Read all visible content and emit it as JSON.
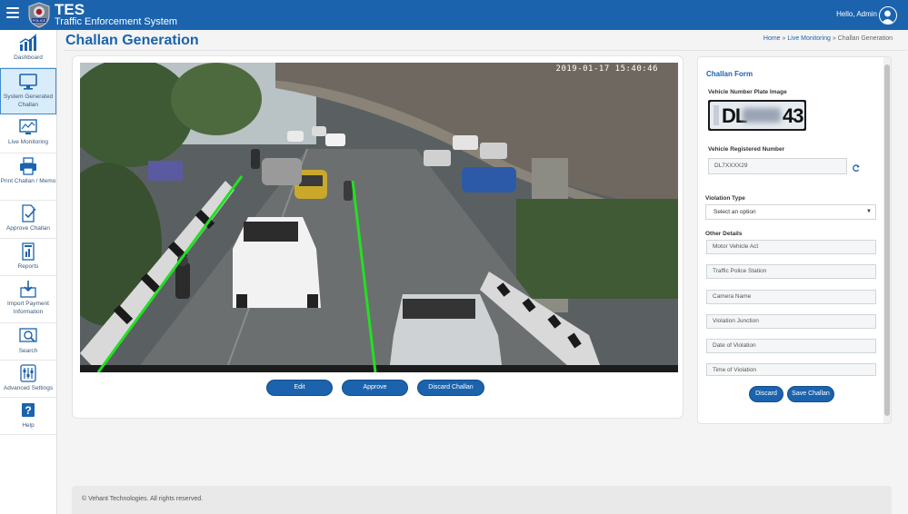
{
  "header": {
    "app_name": "TES",
    "app_subtitle": "Traffic Enforcement System",
    "greeting": "Hello, Admin",
    "logo_text": "POLICE"
  },
  "sidebar": {
    "items": [
      {
        "label": "Dashboard",
        "icon": "bar-chart-icon"
      },
      {
        "label": "System Generated Challan",
        "icon": "monitor-icon",
        "active": true
      },
      {
        "label": "Live Monitoring",
        "icon": "trend-monitor-icon"
      },
      {
        "label": "Print Challan / Memo",
        "icon": "printer-icon"
      },
      {
        "label": "Approve Challan",
        "icon": "approve-document-icon"
      },
      {
        "label": "Reports",
        "icon": "report-icon"
      },
      {
        "label": "Import Payment Information",
        "icon": "import-icon"
      },
      {
        "label": "Search",
        "icon": "search-icon"
      },
      {
        "label": "Advanced Settings",
        "icon": "sliders-icon"
      },
      {
        "label": "Help",
        "icon": "help-icon"
      }
    ]
  },
  "page": {
    "title": "Challan Generation",
    "breadcrumb": {
      "home": "Home",
      "sep1": "»",
      "live": "Live Monitoring",
      "sep2": "»",
      "current": "Challan Generation"
    }
  },
  "camera": {
    "timestamp": "2019-01-17 15:40:46"
  },
  "actions": {
    "edit": "Edit",
    "approve": "Approve",
    "discard_challan": "Discard Challan"
  },
  "form": {
    "title": "Challan Form",
    "plate_image_label": "Vehicle Number Plate Image",
    "plate_visible_left": "DL",
    "plate_visible_right": "43",
    "registered_number_label": "Vehicle Registered Number",
    "registered_number_value": "DL7XXXX29",
    "violation_type_label": "Violation Type",
    "violation_type_value": "Select an option",
    "other_details_label": "Other Details",
    "fields": [
      {
        "placeholder": "Motor Vehicle Act"
      },
      {
        "placeholder": "Traffic Police Station"
      },
      {
        "placeholder": "Camera Name"
      },
      {
        "placeholder": "Violation Junction"
      },
      {
        "placeholder": "Date of Violation"
      },
      {
        "placeholder": "Time of Violation"
      }
    ],
    "discard": "Discard",
    "save": "Save Challan"
  },
  "footer": {
    "text": "© Vehant Technologies. All rights reserved."
  },
  "colors": {
    "brand": "#1b63ad",
    "active_bg": "#d9ecf9",
    "lane_line": "#22e022"
  }
}
